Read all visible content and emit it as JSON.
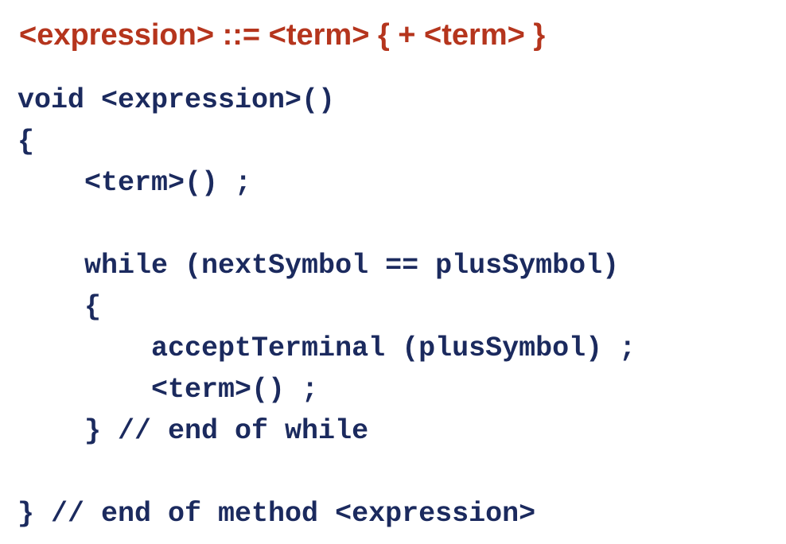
{
  "slide": {
    "grammar_rule": "<expression> ::= <term> { + <term> }",
    "code_lines": [
      "void <expression>()",
      "{",
      "    <term>() ;",
      "",
      "    while (nextSymbol == plusSymbol)",
      "    {",
      "        acceptTerminal (plusSymbol) ;",
      "        <term>() ;",
      "    } // end of while",
      "",
      "} // end of method <expression>"
    ]
  },
  "colors": {
    "grammar_text": "#b5351d",
    "code_text": "#1b2a5e",
    "background": "#ffffff"
  }
}
